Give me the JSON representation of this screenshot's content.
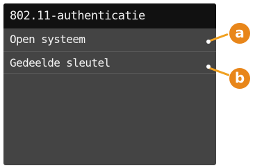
{
  "screen": {
    "title": "802.11-authenticatie",
    "items": [
      {
        "label": "Open systeem",
        "callout": "a"
      },
      {
        "label": "Gedeelde sleutel",
        "callout": "b"
      }
    ]
  },
  "colors": {
    "screen_bg": "#444444",
    "titlebar_bg": "#111111",
    "callout": "#e8861a"
  }
}
